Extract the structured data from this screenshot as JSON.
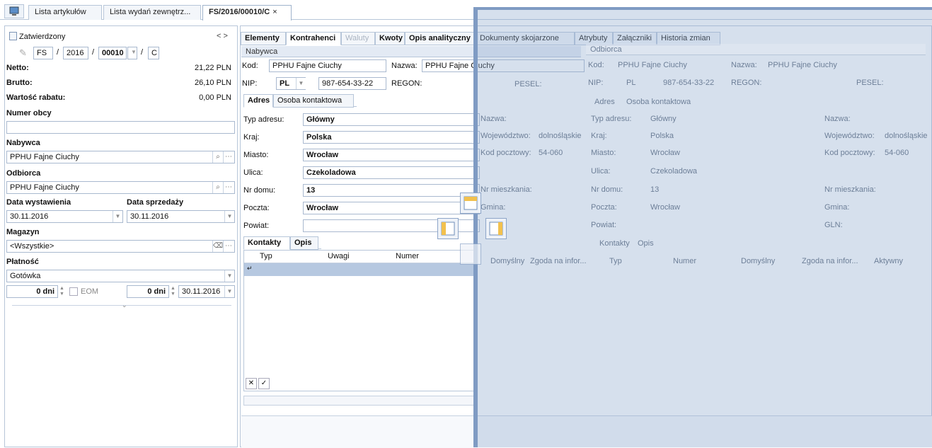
{
  "tabs": [
    {
      "label": "Lista artykułów"
    },
    {
      "label": "Lista wydań zewnętrz..."
    },
    {
      "label": "FS/2016/00010/C"
    }
  ],
  "tab_close": "×",
  "left": {
    "status": "Zatwierdzony",
    "nav": "<  >",
    "doc_series": "FS",
    "doc_year": "2016",
    "doc_number": "00010",
    "doc_suffix": "C",
    "sep": "/",
    "netto_label": "Netto:",
    "netto_value": "21,22 PLN",
    "brutto_label": "Brutto:",
    "brutto_value": "26,10 PLN",
    "rabat_label": "Wartość rabatu:",
    "rabat_value": "0,00 PLN",
    "numer_obcy_label": "Numer obcy",
    "numer_obcy_value": "",
    "nabywca_label": "Nabywca",
    "nabywca_value": "PPHU Fajne Ciuchy",
    "odbiorca_label": "Odbiorca",
    "odbiorca_value": "PPHU Fajne Ciuchy",
    "data_wyst_label": "Data wystawienia",
    "data_wyst_value": "30.11.2016",
    "data_sprz_label": "Data sprzedaży",
    "data_sprz_value": "30.11.2016",
    "magazyn_label": "Magazyn",
    "magazyn_value": "<Wszystkie>",
    "platnosc_label": "Płatność",
    "platnosc_value": "Gotówka",
    "dni1": "0 dni",
    "eom": "EOM",
    "dni2": "0 dni",
    "termin": "30.11.2016"
  },
  "panel_tabs": [
    {
      "label": "Elementy",
      "state": "normal"
    },
    {
      "label": "Kontrahenci",
      "state": "active"
    },
    {
      "label": "Waluty",
      "state": "disabled"
    },
    {
      "label": "Kwoty",
      "state": "normal"
    },
    {
      "label": "Opis analityczny",
      "state": "normal"
    },
    {
      "label": "Dokumenty skojarzone",
      "state": "overlay"
    },
    {
      "label": "Atrybuty",
      "state": "overlay"
    },
    {
      "label": "Załączniki",
      "state": "overlay"
    },
    {
      "label": "Historia zmian",
      "state": "overlay"
    }
  ],
  "nabywca": {
    "header": "Nabywca",
    "kod_label": "Kod:",
    "kod": "PPHU Fajne Ciuchy",
    "nazwa_label": "Nazwa:",
    "nazwa": "PPHU Fajne Ciuchy",
    "nip_label": "NIP:",
    "nip_country": "PL",
    "nip": "987-654-33-22",
    "regon_label": "REGON:",
    "pesel_label": "PESEL:",
    "subtab_adres": "Adres",
    "subtab_osoba": "Osoba kontaktowa",
    "typ_adresu_label": "Typ adresu:",
    "typ_adresu": "Główny",
    "kraj_label": "Kraj:",
    "kraj": "Polska",
    "miasto_label": "Miasto:",
    "miasto": "Wrocław",
    "ulica_label": "Ulica:",
    "ulica": "Czekoladowa",
    "nr_domu_label": "Nr domu:",
    "nr_domu": "13",
    "poczta_label": "Poczta:",
    "poczta": "Wrocław",
    "powiat_label": "Powiat:",
    "nazwa2_label": "Nazwa:",
    "woj_label": "Województwo:",
    "woj": "dolnośląskie",
    "kod_poczt_label": "Kod pocztowy:",
    "kod_poczt": "54-060",
    "nr_mieszk_label": "Nr mieszkania:",
    "gmina_label": "Gmina:",
    "gln_label": "GLN:"
  },
  "odbiorca": {
    "header": "Odbiorca",
    "kod_label": "Kod:",
    "kod": "PPHU Fajne Ciuchy",
    "nazwa_label": "Nazwa:",
    "nazwa": "PPHU Fajne Ciuchy",
    "nip_label": "NIP:",
    "nip_country": "PL",
    "nip": "987-654-33-22",
    "regon_label": "REGON:",
    "pesel_label": "PESEL:",
    "subtab_adres": "Adres",
    "subtab_osoba": "Osoba kontaktowa",
    "typ_adresu_label": "Typ adresu:",
    "typ_adresu": "Główny",
    "kraj_label": "Kraj:",
    "kraj": "Polska",
    "miasto_label": "Miasto:",
    "miasto": "Wrocław",
    "ulica_label": "Ulica:",
    "ulica": "Czekoladowa",
    "nr_domu_label": "Nr domu:",
    "nr_domu": "13",
    "poczta_label": "Poczta:",
    "poczta": "Wrocław",
    "powiat_label": "Powiat:",
    "nazwa2_label": "Nazwa:",
    "woj_label": "Województwo:",
    "woj": "dolnośląskie",
    "kod_poczt_label": "Kod pocztowy:",
    "kod_poczt": "54-060",
    "nr_mieszk_label": "Nr mieszkania:",
    "gmina_label": "Gmina:",
    "gln_label": "GLN:"
  },
  "kontakty": {
    "tab_kontakty": "Kontakty",
    "tab_opis": "Opis",
    "columns": [
      "Typ",
      "Uwagi",
      "Numer",
      "Domyślny",
      "Zgoda na infor...",
      "Aktywny"
    ]
  },
  "colors": {
    "overlay": "#8ca8cd",
    "selection": "#b6c8e0",
    "border": "#b7c6d9"
  }
}
